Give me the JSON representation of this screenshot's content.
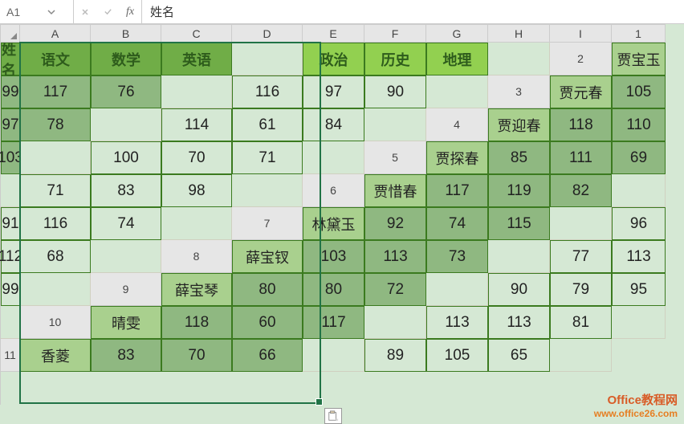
{
  "formula_bar": {
    "name_box": "A1",
    "formula_value": "姓名"
  },
  "columns": [
    "A",
    "B",
    "C",
    "D",
    "E",
    "F",
    "G",
    "H",
    "I"
  ],
  "rows": [
    "1",
    "2",
    "3",
    "4",
    "5",
    "6",
    "7",
    "8",
    "9",
    "10",
    "11"
  ],
  "table1": {
    "headers": [
      "姓名",
      "语文",
      "数学",
      "英语"
    ],
    "data": [
      [
        "贾宝玉",
        "99",
        "117",
        "76"
      ],
      [
        "贾元春",
        "105",
        "97",
        "78"
      ],
      [
        "贾迎春",
        "118",
        "110",
        "103"
      ],
      [
        "贾探春",
        "85",
        "111",
        "69"
      ],
      [
        "贾惜春",
        "117",
        "119",
        "82"
      ],
      [
        "林黛玉",
        "92",
        "74",
        "115"
      ],
      [
        "薛宝钗",
        "103",
        "113",
        "73"
      ],
      [
        "薛宝琴",
        "80",
        "80",
        "72"
      ],
      [
        "晴雯",
        "118",
        "60",
        "117"
      ],
      [
        "香菱",
        "83",
        "70",
        "66"
      ]
    ]
  },
  "table2": {
    "headers": [
      "政治",
      "历史",
      "地理"
    ],
    "data": [
      [
        "116",
        "97",
        "90"
      ],
      [
        "114",
        "61",
        "84"
      ],
      [
        "100",
        "70",
        "71"
      ],
      [
        "71",
        "83",
        "98"
      ],
      [
        "91",
        "116",
        "74"
      ],
      [
        "96",
        "112",
        "68"
      ],
      [
        "77",
        "113",
        "99"
      ],
      [
        "90",
        "79",
        "95"
      ],
      [
        "113",
        "113",
        "81"
      ],
      [
        "89",
        "105",
        "65"
      ]
    ]
  },
  "watermark": {
    "line1": "Office教程网",
    "line2": "www.office26.com"
  }
}
